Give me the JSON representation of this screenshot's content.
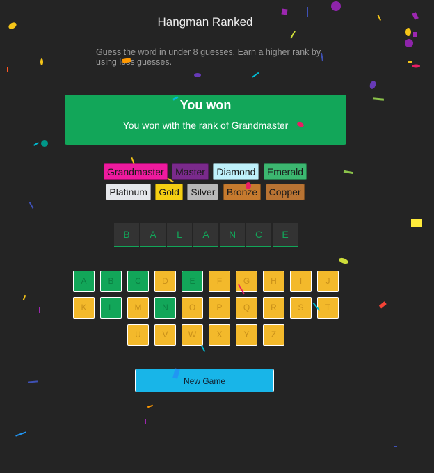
{
  "page": {
    "title": "Hangman Ranked",
    "subtitle": "Guess the word in under 8 guesses. Earn a higher rank by using less guesses."
  },
  "result": {
    "heading": "You won",
    "message": "You won with the rank of Grandmaster"
  },
  "ranks": {
    "row1": [
      {
        "label": "Grandmaster",
        "bg": "#ee1a9e",
        "fg": "#1a1a1a"
      },
      {
        "label": "Master",
        "bg": "#7a2a8c",
        "fg": "#1a1a1a"
      },
      {
        "label": "Diamond",
        "bg": "#bff1fb",
        "fg": "#1a1a1a"
      },
      {
        "label": "Emerald",
        "bg": "#3cb770",
        "fg": "#1a1a1a"
      }
    ],
    "row2": [
      {
        "label": "Platinum",
        "bg": "#e5e7eb",
        "fg": "#1a1a1a"
      },
      {
        "label": "Gold",
        "bg": "#f5cf13",
        "fg": "#1a1a1a"
      },
      {
        "label": "Silver",
        "bg": "#b8b8b8",
        "fg": "#1a1a1a"
      },
      {
        "label": "Bronze",
        "bg": "#c67a2e",
        "fg": "#1a1a1a"
      },
      {
        "label": "Copper",
        "bg": "#b87333",
        "fg": "#1a1a1a"
      }
    ]
  },
  "word": [
    "B",
    "A",
    "L",
    "A",
    "N",
    "C",
    "E"
  ],
  "keyboard": {
    "rows": [
      [
        {
          "letter": "A",
          "state": "correct"
        },
        {
          "letter": "B",
          "state": "correct"
        },
        {
          "letter": "C",
          "state": "correct"
        },
        {
          "letter": "D",
          "state": "wrong"
        },
        {
          "letter": "E",
          "state": "correct"
        },
        {
          "letter": "F",
          "state": "unused"
        },
        {
          "letter": "G",
          "state": "unused"
        },
        {
          "letter": "H",
          "state": "unused"
        },
        {
          "letter": "I",
          "state": "unused"
        },
        {
          "letter": "J",
          "state": "unused"
        }
      ],
      [
        {
          "letter": "K",
          "state": "unused"
        },
        {
          "letter": "L",
          "state": "correct"
        },
        {
          "letter": "M",
          "state": "unused"
        },
        {
          "letter": "N",
          "state": "correct"
        },
        {
          "letter": "O",
          "state": "unused"
        },
        {
          "letter": "P",
          "state": "unused"
        },
        {
          "letter": "Q",
          "state": "unused"
        },
        {
          "letter": "R",
          "state": "unused"
        },
        {
          "letter": "S",
          "state": "unused"
        },
        {
          "letter": "T",
          "state": "unused"
        }
      ],
      [
        {
          "letter": "U",
          "state": "unused"
        },
        {
          "letter": "V",
          "state": "unused"
        },
        {
          "letter": "W",
          "state": "unused"
        },
        {
          "letter": "X",
          "state": "unused"
        },
        {
          "letter": "Y",
          "state": "unused"
        },
        {
          "letter": "Z",
          "state": "unused"
        }
      ]
    ]
  },
  "actions": {
    "new_game_label": "New Game"
  },
  "colors": {
    "background": "#242424",
    "success": "#12a659",
    "key_unused": "#f3b92b",
    "button": "#18b5e8"
  }
}
